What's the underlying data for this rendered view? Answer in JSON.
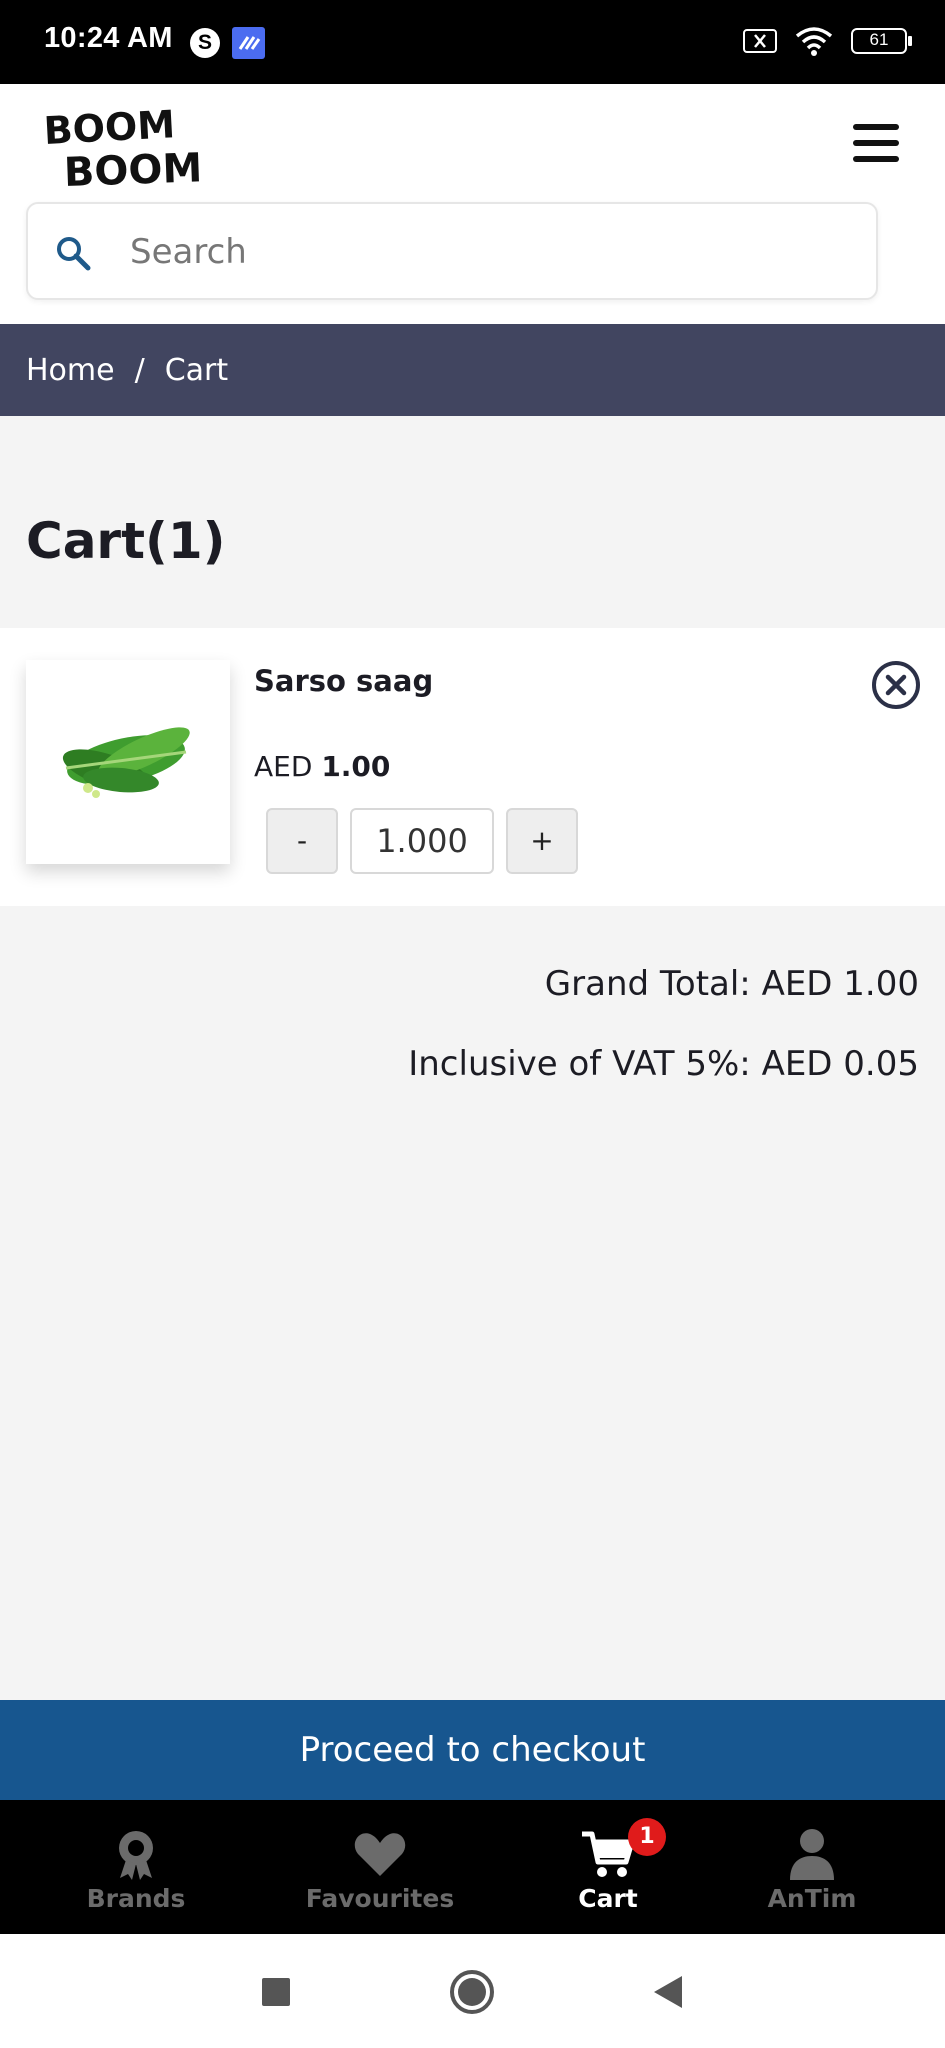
{
  "status_bar": {
    "time": "10:24 AM",
    "s_icon_letter": "S",
    "battery": "61",
    "icons": [
      "skype-icon",
      "app-icon",
      "sim-x-icon",
      "wifi-icon",
      "battery-icon"
    ]
  },
  "header": {
    "logo_line1": "BOOM",
    "logo_line2": "BOOM",
    "search_placeholder": "Search"
  },
  "breadcrumb": {
    "items": [
      {
        "label": "Home"
      },
      {
        "label": "Cart"
      }
    ],
    "separator": "/"
  },
  "cart": {
    "title": "Cart(1)",
    "items": [
      {
        "name": "Sarso saag",
        "currency": "AED",
        "price": "1.00",
        "quantity": "1.000",
        "minus_label": "-",
        "plus_label": "+"
      }
    ],
    "grand_total": "Grand Total: AED 1.00",
    "vat": "Inclusive of VAT 5%: AED 0.05",
    "checkout_label": "Proceed to checkout"
  },
  "bottom_nav": {
    "items": [
      {
        "label": "Brands",
        "icon": "badge-icon"
      },
      {
        "label": "Favourites",
        "icon": "heart-icon"
      },
      {
        "label": "Cart",
        "icon": "cart-icon",
        "badge": "1",
        "active": true
      },
      {
        "label": "AnTim",
        "icon": "user-icon"
      }
    ]
  },
  "colors": {
    "breadcrumb_bg": "#414560",
    "checkout_bg": "#17568f",
    "badge_bg": "#e01b1b",
    "page_bg": "#f4f4f4"
  }
}
